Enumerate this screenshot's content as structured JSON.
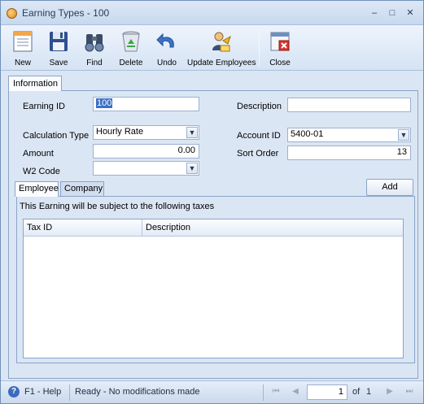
{
  "window": {
    "title": "Earning Types - 100",
    "controls": {
      "minimize": "–",
      "maximize": "□",
      "close": "✕"
    }
  },
  "toolbar": {
    "new": "New",
    "save": "Save",
    "find": "Find",
    "delete": "Delete",
    "undo": "Undo",
    "update_employees": "Update Employees",
    "close": "Close"
  },
  "tabs": {
    "information": "Information"
  },
  "form": {
    "earning_id_label": "Earning ID",
    "earning_id_value": "100",
    "description_label": "Description",
    "description_value": "",
    "calc_type_label": "Calculation Type",
    "calc_type_value": "Hourly Rate",
    "account_id_label": "Account ID",
    "account_id_value": "5400-01",
    "amount_label": "Amount",
    "amount_value": "0.00",
    "sort_order_label": "Sort Order",
    "sort_order_value": "13",
    "w2_code_label": "W2 Code",
    "w2_code_value": ""
  },
  "subtabs": {
    "employee": "Employee",
    "company": "Company"
  },
  "add_button": "Add",
  "subpanel": {
    "description": "This Earning will be subject to the following taxes",
    "columns": [
      "Tax ID",
      "Description"
    ]
  },
  "statusbar": {
    "help": "F1 - Help",
    "status": "Ready - No modifications made",
    "page": "1",
    "of": "of",
    "total": "1"
  }
}
